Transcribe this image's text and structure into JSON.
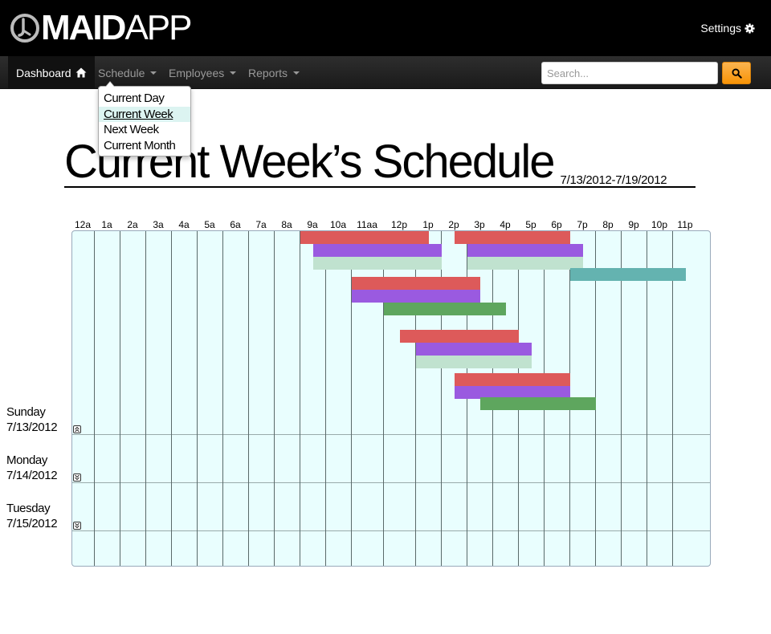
{
  "header": {
    "logo_bold": "MAID",
    "logo_light": "APP",
    "settings_label": "Settings"
  },
  "nav": {
    "items": [
      {
        "label": "Dashboard",
        "active": true
      },
      {
        "label": "Schedule",
        "active": false
      },
      {
        "label": "Employees",
        "active": false
      },
      {
        "label": "Reports",
        "active": false
      }
    ],
    "search_placeholder": "Search..."
  },
  "schedule_menu": {
    "items": [
      {
        "label": "Current Day",
        "selected": false
      },
      {
        "label": "Current Week",
        "selected": true
      },
      {
        "label": "Next Week",
        "selected": false
      },
      {
        "label": "Current Month",
        "selected": false
      }
    ]
  },
  "page": {
    "title": "Current Week’s Schedule",
    "date_range": "7/13/2012-7/19/2012"
  },
  "hours": [
    "12a",
    "1a",
    "2a",
    "3a",
    "4a",
    "5a",
    "6a",
    "7a",
    "8a",
    "9a",
    "10a",
    "11aa",
    "12p",
    "1p",
    "2p",
    "3p",
    "4p",
    "5p",
    "6p",
    "7p",
    "8p",
    "9p",
    "10p",
    "11p"
  ],
  "days": [
    {
      "name": "Sunday",
      "date": "7/13/2012",
      "expanded": true
    },
    {
      "name": "Monday",
      "date": "7/14/2012",
      "expanded": false
    },
    {
      "name": "Tuesday",
      "date": "7/15/2012",
      "expanded": false
    }
  ],
  "shift_colors": {
    "red": "#dd5a5a",
    "purple": "#9a5ae0",
    "mint": "#c0e2cf",
    "teal": "#64b3b0",
    "green": "#5ea65e"
  },
  "shifts": [
    {
      "start": 9.0,
      "end": 13.5,
      "row": 0,
      "color": "red"
    },
    {
      "start": 14.5,
      "end": 19.0,
      "row": 0,
      "color": "red"
    },
    {
      "start": 9.5,
      "end": 14.0,
      "row": 1,
      "color": "purple"
    },
    {
      "start": 15.0,
      "end": 19.5,
      "row": 1,
      "color": "purple"
    },
    {
      "start": 9.5,
      "end": 14.0,
      "row": 2,
      "color": "mint"
    },
    {
      "start": 15.0,
      "end": 19.5,
      "row": 2,
      "color": "mint"
    },
    {
      "start": 19.0,
      "end": 23.5,
      "row": 3,
      "color": "teal"
    },
    {
      "start": 11.0,
      "end": 15.5,
      "row": 4,
      "color": "red"
    },
    {
      "start": 11.0,
      "end": 15.5,
      "row": 5,
      "color": "purple"
    },
    {
      "start": 12.0,
      "end": 16.5,
      "row": 6,
      "color": "green"
    },
    {
      "start": 12.5,
      "end": 17.0,
      "row": 8,
      "color": "red"
    },
    {
      "start": 13.0,
      "end": 17.5,
      "row": 9,
      "color": "purple"
    },
    {
      "start": 13.0,
      "end": 17.5,
      "row": 10,
      "color": "mint"
    },
    {
      "start": 14.5,
      "end": 19.0,
      "row": 11,
      "color": "red"
    },
    {
      "start": 14.5,
      "end": 19.0,
      "row": 12,
      "color": "purple"
    },
    {
      "start": 15.5,
      "end": 20.0,
      "row": 13,
      "color": "green"
    }
  ]
}
